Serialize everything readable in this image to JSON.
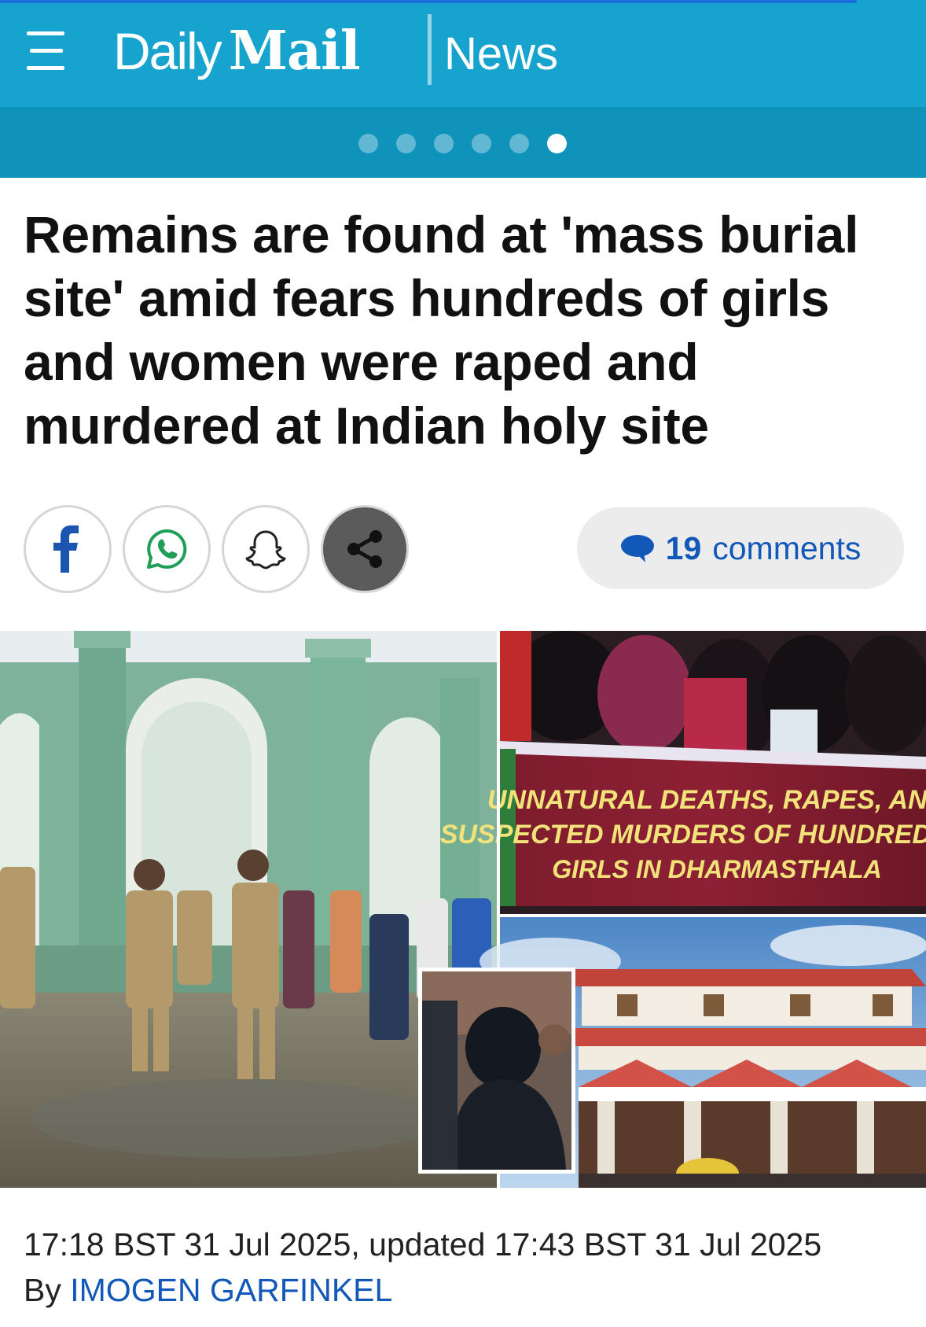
{
  "header": {
    "logo_daily": "Daily",
    "logo_mail": "Mail",
    "section": "News",
    "menu_icon": "hamburger-menu-icon",
    "background_color": "#16a3ce",
    "carousel_dots": 6,
    "active_dot": 6
  },
  "article": {
    "headline": "Remains are found at 'mass burial site' amid fears hundreds of girls and women were raped and murdered at Indian holy site",
    "share": {
      "facebook_icon": "facebook-icon",
      "whatsapp_icon": "whatsapp-icon",
      "snapchat_icon": "snapchat-icon",
      "share_icon": "share-icon"
    },
    "comments": {
      "count": "19",
      "label": "comments",
      "icon": "speech-bubble-icon"
    },
    "image": {
      "banner_line1": "UNNATURAL DEATHS, RAPES, AND",
      "banner_line2": "SUSPECTED MURDERS OF HUNDREDS OF",
      "banner_line3": "GIRLS IN DHARMASTHALA"
    },
    "dateline": "17:18 BST 31 Jul 2025, updated 17:43 BST 31 Jul 2025",
    "byline_prefix": "By",
    "author": "IMOGEN GARFINKEL"
  }
}
